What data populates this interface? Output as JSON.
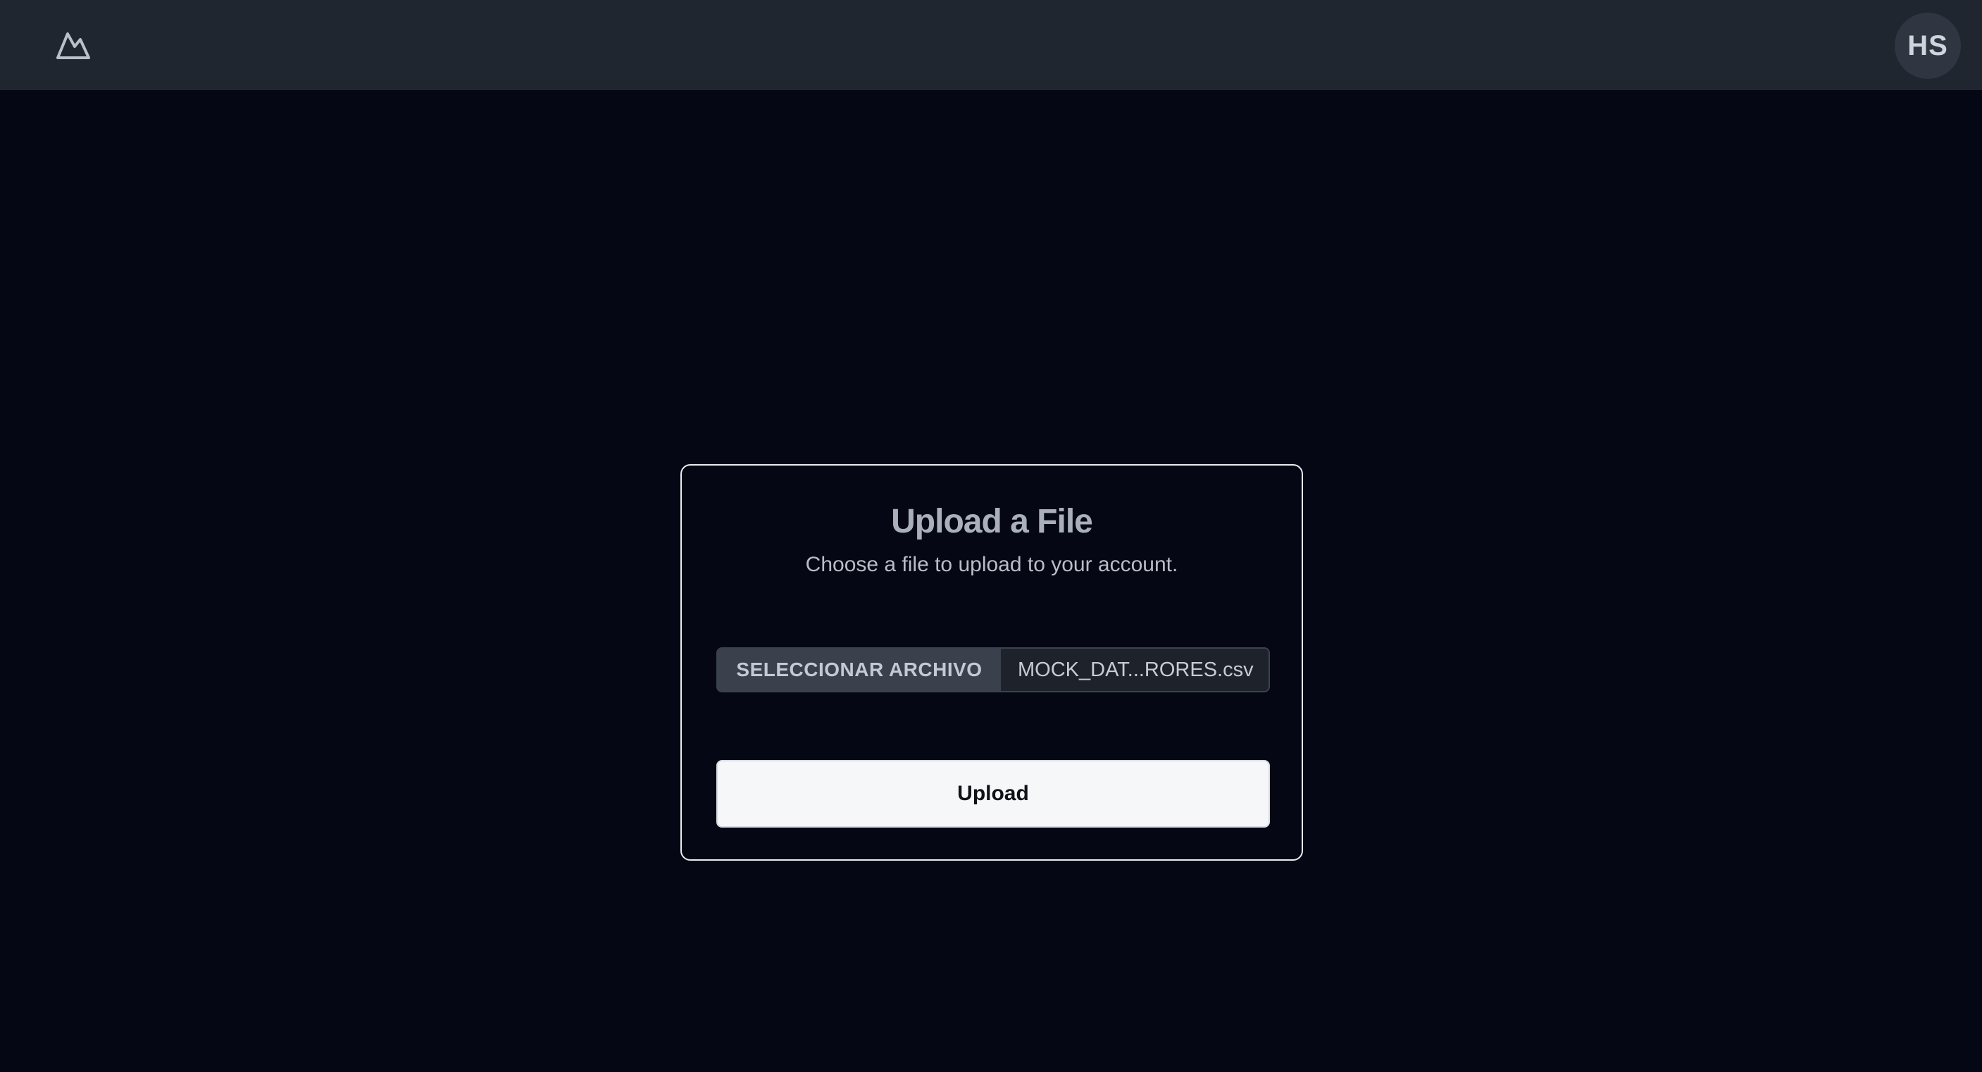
{
  "header": {
    "logo_icon": "mountain-icon",
    "avatar_initials": "HS"
  },
  "upload_card": {
    "title": "Upload a File",
    "subtitle": "Choose a file to upload to your account.",
    "file_input": {
      "button_label": "SELECCIONAR ARCHIVO",
      "selected_file": "MOCK_DAT...RORES.csv"
    },
    "submit_label": "Upload"
  },
  "colors": {
    "page_background": "#050814",
    "header_background": "#202630",
    "card_border": "#e9ecf1",
    "button_background": "#f6f7f9"
  }
}
